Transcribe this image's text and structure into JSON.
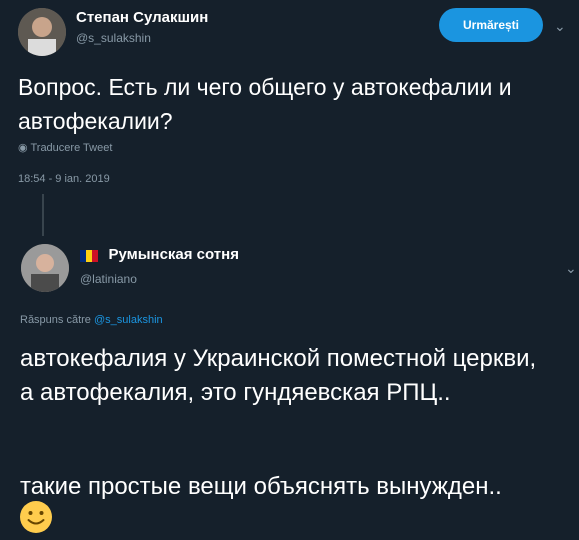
{
  "tweet": {
    "author_name": "Степан Сулакшин",
    "author_handle": "@s_sulakshin",
    "follow_label": "Urmărești",
    "text": "Вопрос. Есть ли чего общего у автокефалии и автофекалии?",
    "translate_label": "Traducere Tweet",
    "timestamp": "18:54 - 9 ian. 2019"
  },
  "reply": {
    "author_name": "Румынская сотня",
    "author_handle": "@latiniano",
    "replying_prefix": "Răspuns către",
    "replying_to": "@s_sulakshin",
    "paragraph1": "автокефалия у Украинской поместной церкви, а автофекалия, это гундяевская РПЦ..",
    "paragraph2": "такие простые вещи объяснять вынужден.."
  },
  "icons": {
    "chevron": "chevron-down-icon",
    "globe": "globe-icon",
    "flag": "romania-flag-icon",
    "emoji": "slightly-smiling-face-icon"
  },
  "colors": {
    "background": "#15202b",
    "accent": "#1b95e0",
    "muted": "#8899a6"
  }
}
